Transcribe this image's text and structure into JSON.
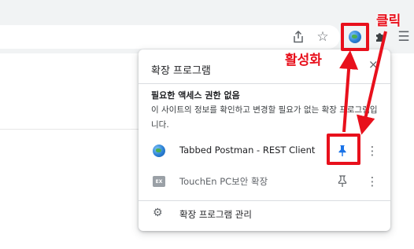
{
  "toolbar": {
    "icons": [
      "share-icon",
      "star-icon",
      "extension-globe-icon",
      "puzzle-icon",
      "menu-icon"
    ]
  },
  "popup": {
    "title": "확장 프로그램",
    "close_glyph": "×",
    "section_title": "필요한 액세스 권한 없음",
    "section_desc": "이 사이트의 정보를 확인하고 변경할 필요가 없는 확장 프로그램입니다.",
    "extensions": [
      {
        "name": "Tabbed Postman - REST Client",
        "pinned": true,
        "icon": "globe-icon"
      },
      {
        "name": "TouchEn PC보안 확장",
        "pinned": false,
        "icon": "ex-badge-icon",
        "icon_text": "EX"
      }
    ],
    "manage_label": "확장 프로그램 관리"
  },
  "annotations": {
    "activate_label": "활성화",
    "click_label": "클릭",
    "color": "#e8101c"
  },
  "colors": {
    "pin_active": "#1a73e8",
    "pin_inactive": "#5f6368"
  }
}
